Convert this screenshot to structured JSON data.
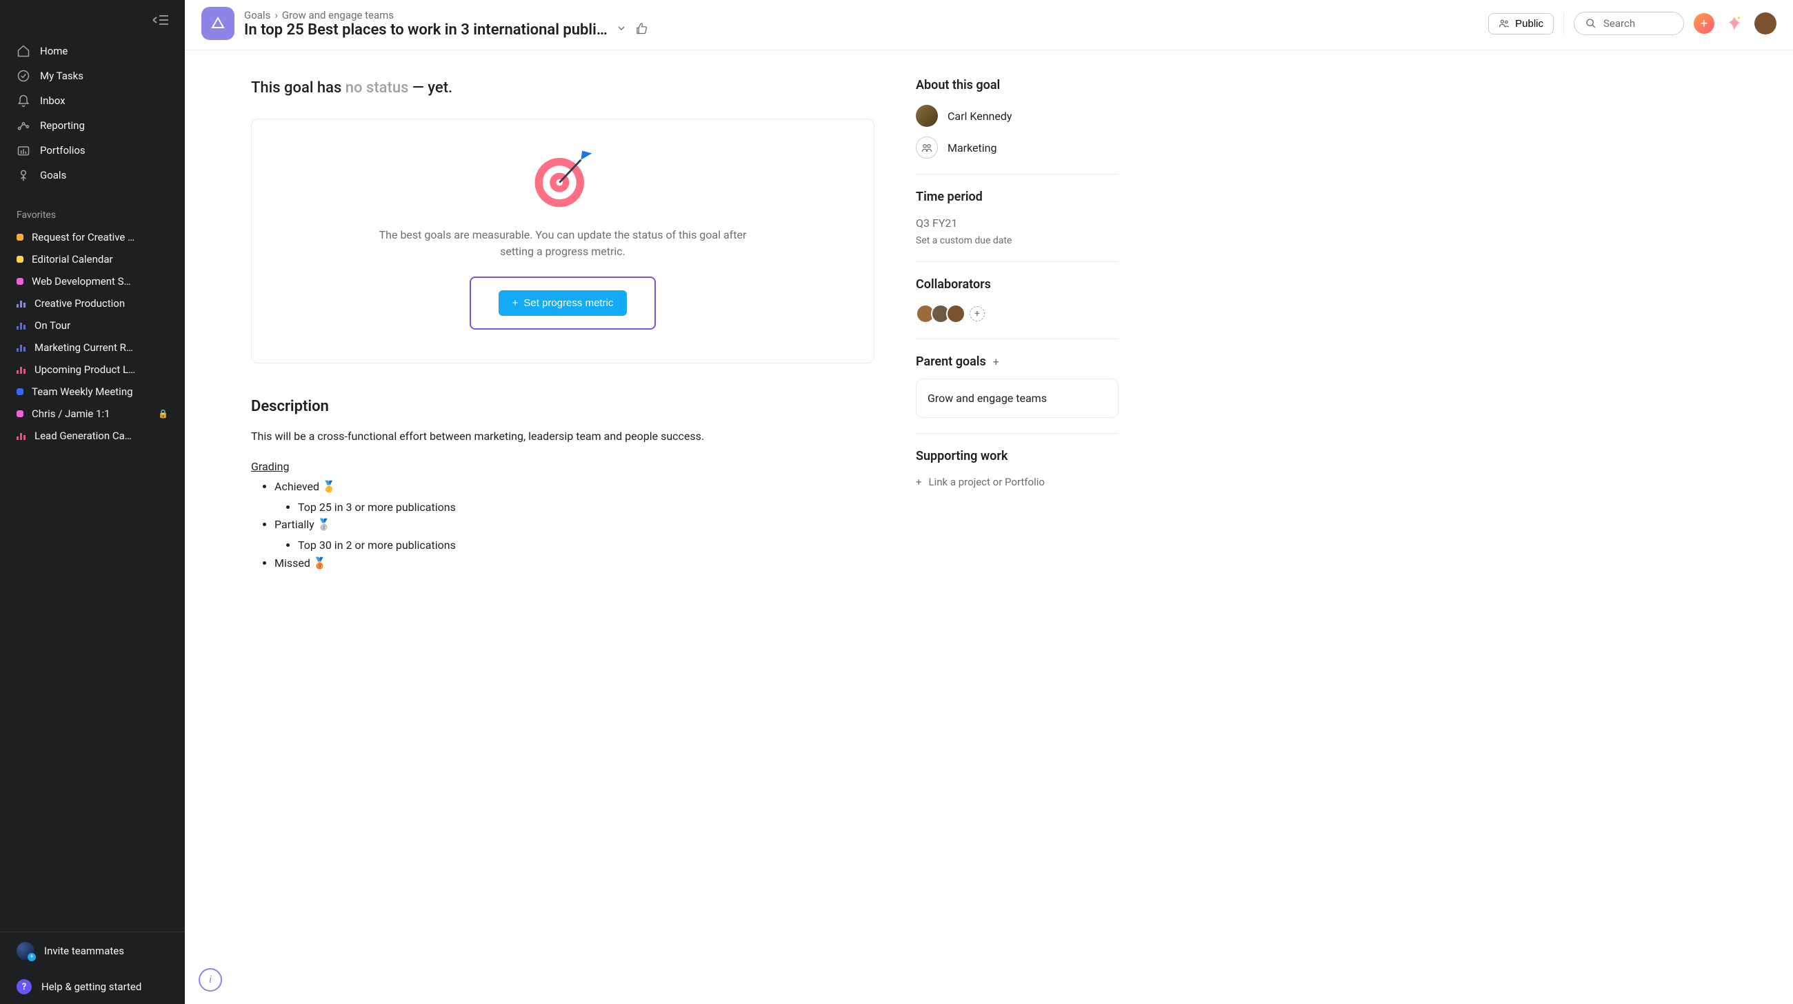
{
  "sidebar": {
    "nav": [
      {
        "label": "Home",
        "icon": "home"
      },
      {
        "label": "My Tasks",
        "icon": "check"
      },
      {
        "label": "Inbox",
        "icon": "bell"
      },
      {
        "label": "Reporting",
        "icon": "reporting"
      },
      {
        "label": "Portfolios",
        "icon": "portfolio"
      },
      {
        "label": "Goals",
        "icon": "goals"
      }
    ],
    "favorites_header": "Favorites",
    "favorites": [
      {
        "label": "Request for Creative …",
        "kind": "dot",
        "color": "#fca93a"
      },
      {
        "label": "Editorial Calendar",
        "kind": "dot",
        "color": "#fcd24f"
      },
      {
        "label": "Web Development S…",
        "kind": "dot",
        "color": "#f65ddb"
      },
      {
        "label": "Creative Production",
        "kind": "bars",
        "color": "#8d84e8"
      },
      {
        "label": "On Tour",
        "kind": "bars",
        "color": "#4f6fde"
      },
      {
        "label": "Marketing Current R…",
        "kind": "bars",
        "color": "#4f6fde"
      },
      {
        "label": "Upcoming Product L…",
        "kind": "bars",
        "color": "#ee4e7a"
      },
      {
        "label": "Team Weekly Meeting",
        "kind": "dot",
        "color": "#3369ff"
      },
      {
        "label": "Chris / Jamie 1:1",
        "kind": "dot",
        "color": "#f65ddb",
        "locked": true
      },
      {
        "label": "Lead Generation Ca…",
        "kind": "bars",
        "color": "#ee4e7a"
      }
    ],
    "invite": "Invite teammates",
    "help": "Help & getting started"
  },
  "breadcrumb": {
    "root": "Goals",
    "parent": "Grow and engage teams",
    "sep": "›"
  },
  "title": "In top 25 Best places to work in 3 international publi…",
  "public_label": "Public",
  "search_placeholder": "Search",
  "status": {
    "pre": "This goal has ",
    "mid": "no status",
    "suf": " — yet."
  },
  "empty_card": {
    "text": "The best goals are measurable. You can update the status of this goal after setting a progress metric.",
    "button": "Set progress metric"
  },
  "description": {
    "heading": "Description",
    "body": "This will be a cross-functional effort between marketing, leadersip team and people success.",
    "grading_label": "Grading",
    "items": [
      {
        "label": "Achieved 🥇",
        "sub": "Top 25 in 3 or more publications"
      },
      {
        "label": "Partially 🥈",
        "sub": "Top 30 in 2 or more publications"
      },
      {
        "label": "Missed 🥉"
      }
    ]
  },
  "about": {
    "heading": "About this goal",
    "owner": "Carl Kennedy",
    "team": "Marketing"
  },
  "time_period": {
    "heading": "Time period",
    "value": "Q3 FY21",
    "link": "Set a custom due date"
  },
  "collaborators": {
    "heading": "Collaborators",
    "count": 3,
    "colors": [
      "#9a6b3a",
      "#6e5a44",
      "#7a5230"
    ]
  },
  "parent_goals": {
    "heading": "Parent goals",
    "card": "Grow and engage teams"
  },
  "supporting": {
    "heading": "Supporting work",
    "link": "Link a project or Portfolio"
  }
}
